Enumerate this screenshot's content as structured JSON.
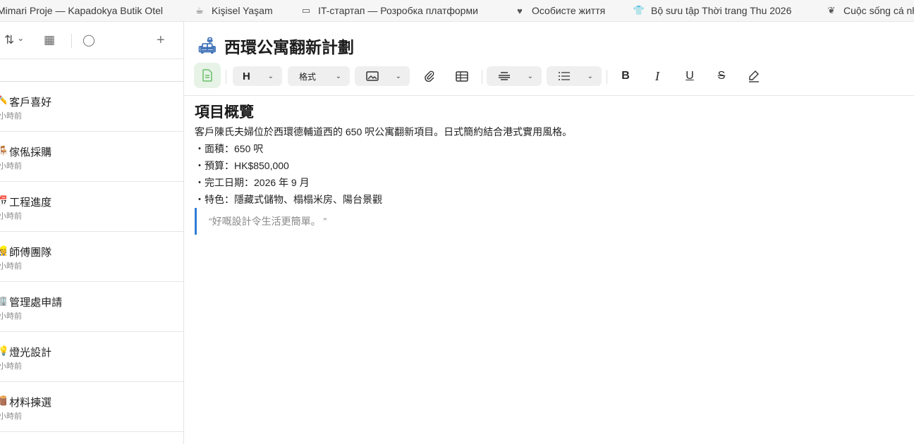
{
  "tabs": [
    {
      "icon": "building-icon",
      "glyph": "",
      "label": "Mimari Proje — Kapadokya Butik Otel"
    },
    {
      "icon": "cup-icon",
      "glyph": "☕",
      "label": "Kişisel Yaşam"
    },
    {
      "icon": "laptop-icon",
      "glyph": "▭",
      "label": "IT-стартап — Розробка платформи"
    },
    {
      "icon": "heart-icon",
      "glyph": "♥",
      "label": "Особисте життя"
    },
    {
      "icon": "tshirt-icon",
      "glyph": "👕",
      "label": "Bộ sưu tập Thời trang Thu 2026"
    },
    {
      "icon": "leaf-icon",
      "glyph": "❦",
      "label": "Cuộc sống cá nhân"
    }
  ],
  "sidebar": {
    "sort_glyph": "⇅",
    "sort_chev": "⌄",
    "view_glyph": "▦",
    "check_glyph": "◯",
    "add_glyph": "+",
    "items": [
      {
        "emoji": "✏️",
        "title": "客戶喜好",
        "time": "小時前"
      },
      {
        "emoji": "🪑",
        "title": "傢俬採購",
        "time": "小時前"
      },
      {
        "emoji": "📅",
        "title": "工程進度",
        "time": "小時前"
      },
      {
        "emoji": "👷",
        "title": "師傅團隊",
        "time": "小時前"
      },
      {
        "emoji": "🏢",
        "title": "管理處申請",
        "time": "小時前"
      },
      {
        "emoji": "💡",
        "title": "燈光設計",
        "time": "小時前"
      },
      {
        "emoji": "🪵",
        "title": "材料揀選",
        "time": "小時前"
      }
    ]
  },
  "document": {
    "title_icon": "🛋",
    "title": "西環公寓翻新計劃",
    "toolbar": {
      "heading_label": "H",
      "format_label": "格式",
      "chevron": "⌄",
      "bold": "B",
      "italic": "I",
      "underline": "U",
      "strike": "S"
    },
    "heading": "項目概覽",
    "intro": "客戶陳氏夫婦位於西環德輔道西的 650 呎公寓翻新項目。日式簡約結合港式實用風格。",
    "bullets": [
      "・面積：650 呎",
      "・預算：HK$850,000",
      "・完工日期：2026 年 9 月",
      "・特色：隱藏式儲物、榻榻米房、陽台景觀"
    ],
    "quote": "“好嘅設計令生活更簡單。 ”"
  }
}
